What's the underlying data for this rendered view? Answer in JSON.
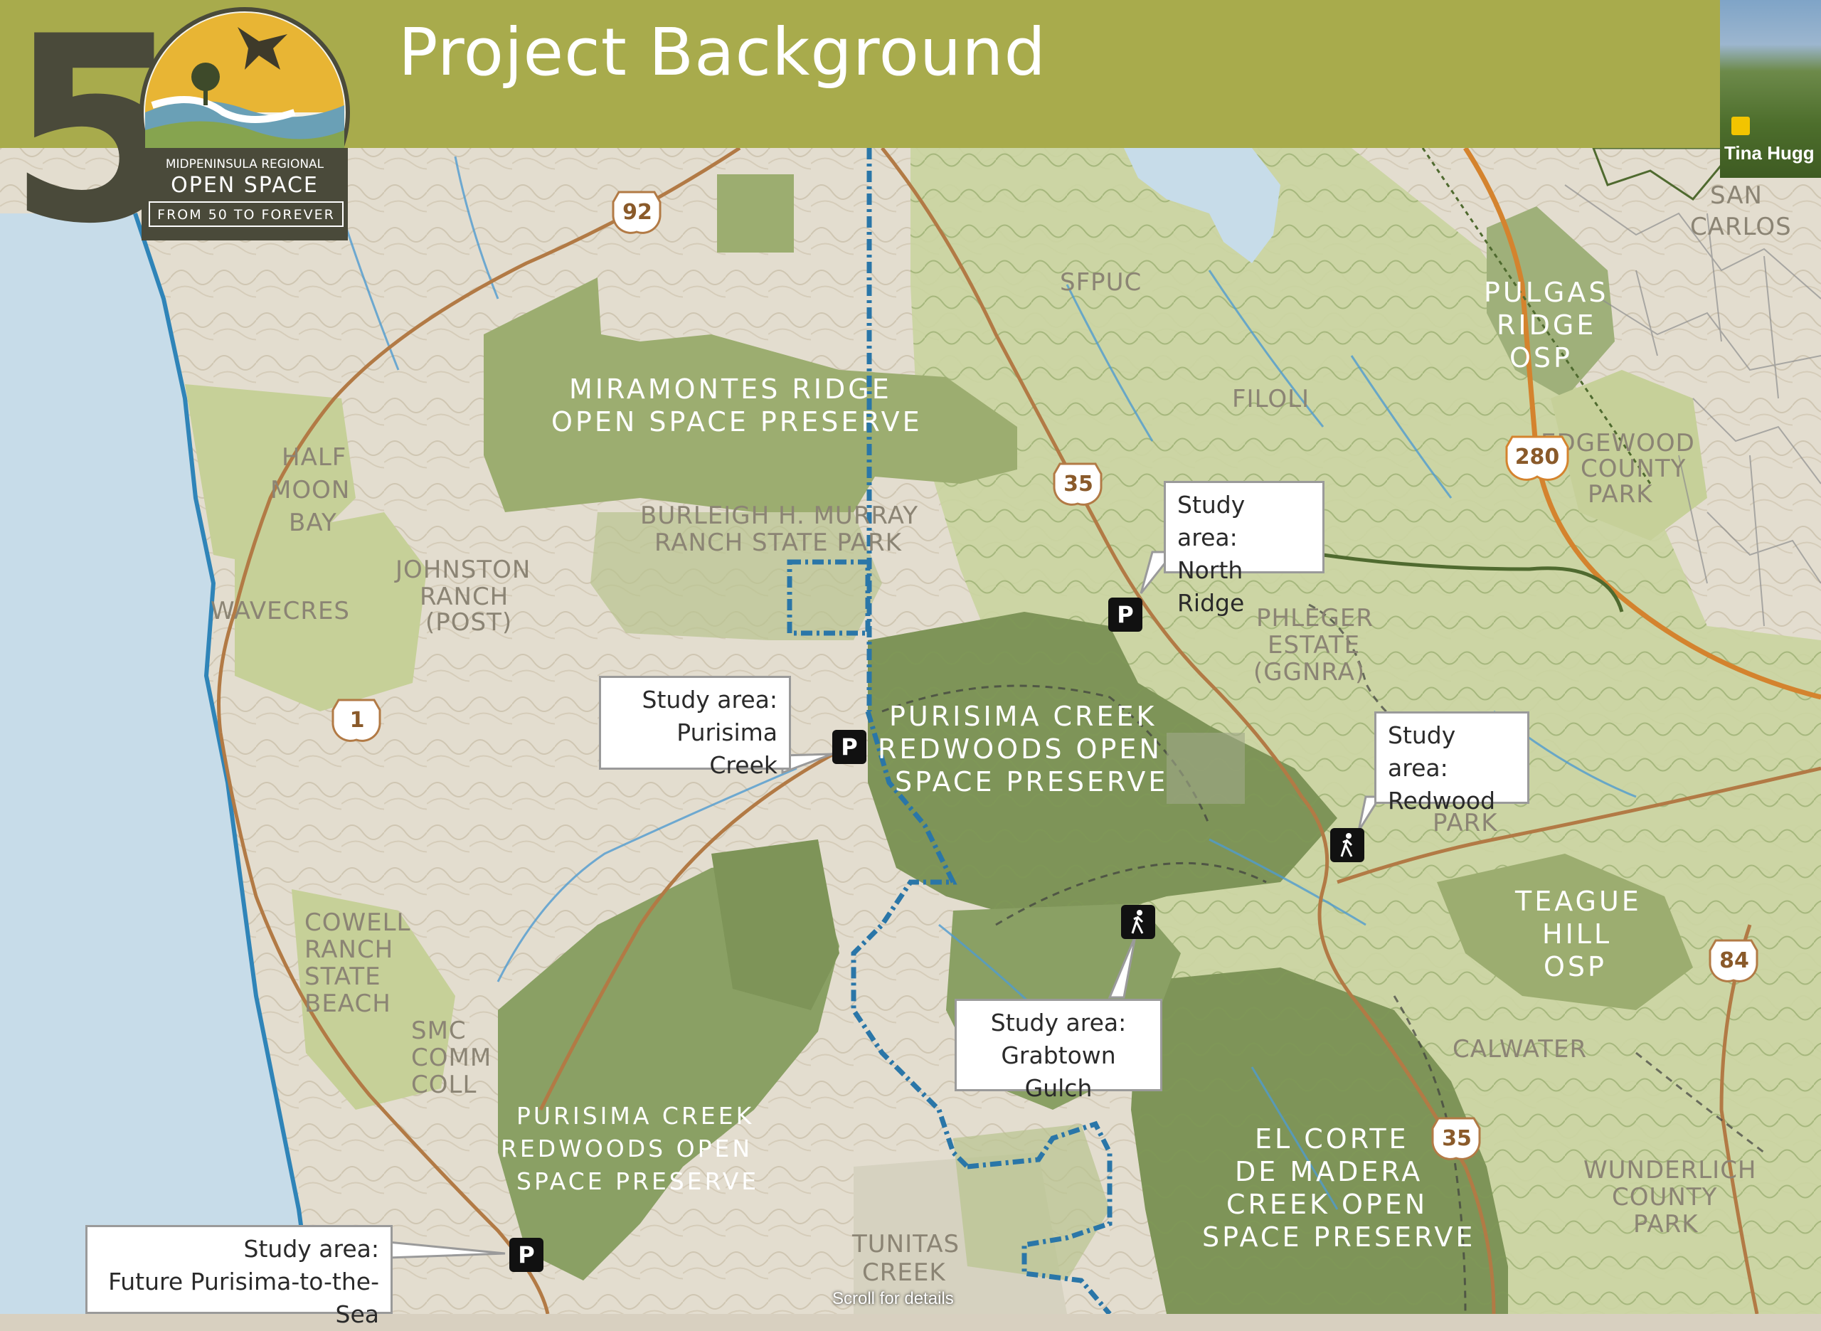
{
  "header": {
    "title": "Project Background"
  },
  "logo": {
    "number": "5",
    "line1": "MIDPENINSULA REGIONAL",
    "line2": "OPEN SPACE",
    "line3": "FROM 50 TO FOREVER"
  },
  "video": {
    "participant_name": "Tina Hugg"
  },
  "map": {
    "places": {
      "half_moon_bay": [
        "HALF",
        "MOON",
        "BAY"
      ],
      "wavecrest": "WAVECRES",
      "johnston_ranch": [
        "JOHNSTON",
        "RANCH",
        "(POST)"
      ],
      "miramontes": [
        "MIRAMONTES RIDGE",
        "OPEN SPACE PRESERVE"
      ],
      "burleigh": [
        "BURLEIGH H. MURRAY",
        "RANCH STATE PARK"
      ],
      "purisima_upper": [
        "PURISIMA CREEK",
        "REDWOODS OPEN",
        "SPACE PRESERVE"
      ],
      "purisima_lower": [
        "PURISIMA CREEK",
        "REDWOODS OPEN",
        "SPACE PRESERVE"
      ],
      "cowell": [
        "COWELL",
        "RANCH",
        "STATE",
        "BEACH"
      ],
      "smc": [
        "SMC",
        "COMM",
        "COLL"
      ],
      "tunitas": [
        "TUNITAS",
        "CREEK"
      ],
      "sfpuc": "SFPUC",
      "filoli": "FILOLI",
      "phleger": [
        "PHLEGER",
        "ESTATE",
        "(GGNRA)"
      ],
      "pulgas": [
        "PULGAS",
        "RIDGE",
        "OSP"
      ],
      "san_carlos": [
        "SAN",
        "CARLOS"
      ],
      "edgewood": [
        "EDGEWOOD",
        "COUNTY",
        "PARK"
      ],
      "teague": [
        "TEAGUE",
        "HILL",
        "OSP"
      ],
      "calwater": "CALWATER",
      "el_corte": [
        "EL CORTE",
        "DE MADERA",
        "CREEK OPEN",
        "SPACE PRESERVE"
      ],
      "wunderlich": [
        "WUNDERLICH",
        "COUNTY",
        "PARK"
      ],
      "park": "PARK"
    },
    "routes": [
      "92",
      "35",
      "35",
      "1",
      "280",
      "84"
    ],
    "callouts": {
      "north_ridge": [
        "Study area:",
        "North Ridge"
      ],
      "purisima": [
        "Study area:",
        "Purisima Creek"
      ],
      "redwood": [
        "Study area:",
        "Redwood"
      ],
      "grabtown": [
        "Study area:",
        "Grabtown Gulch"
      ],
      "future": [
        "Study area:",
        "Future Purisima-to-the-Sea"
      ]
    },
    "icons": {
      "parking": "P"
    }
  },
  "footer": {
    "scroll_hint": "Scroll for details"
  }
}
